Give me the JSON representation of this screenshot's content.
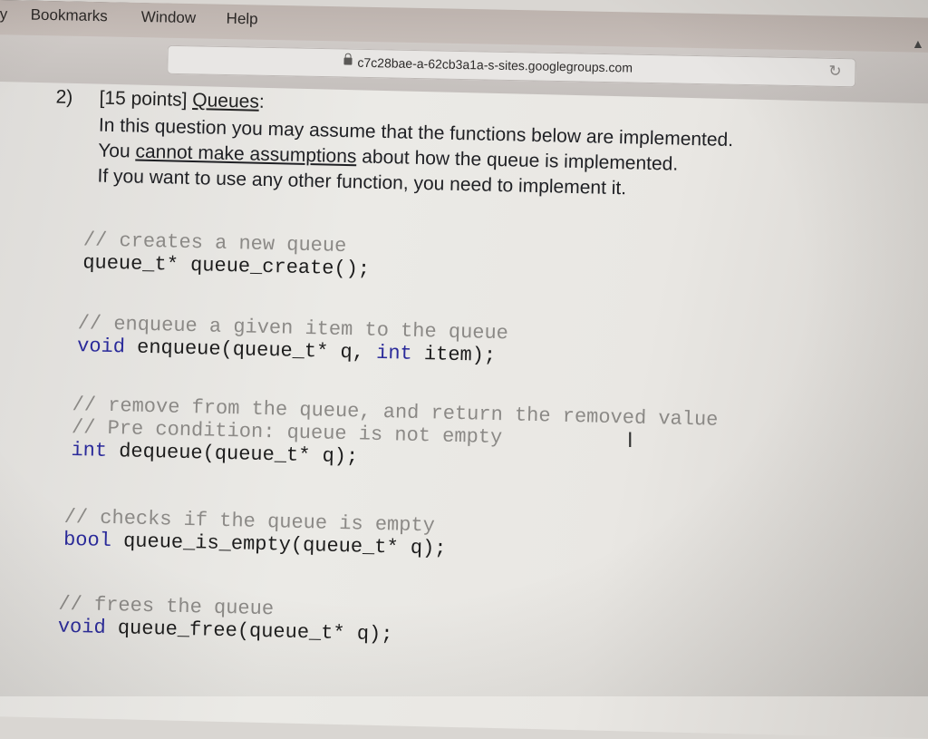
{
  "menubar": {
    "items": [
      "y",
      "Bookmarks",
      "Window",
      "Help"
    ]
  },
  "toolbar": {
    "url": "c7c28bae-a-62cb3a1a-s-sites.googlegroups.com",
    "lock_icon": "lock-icon",
    "reload_icon": "reload-icon",
    "share_icon": "share-icon"
  },
  "question": {
    "number": "2)",
    "points": "[15 points] ",
    "title": "Queues",
    "title_suffix": ":",
    "line1": "In this question you may assume that the functions below are implemented.",
    "line2_prefix": "You ",
    "line2_underlined": "cannot make assumptions",
    "line2_suffix": " about how the queue is implemented.",
    "line3": "If you want to use any other function, you need to implement it."
  },
  "code": {
    "blocks": [
      {
        "comments": [
          "// creates a new queue"
        ],
        "type": "queue_t*",
        "signature": " queue_create();"
      },
      {
        "comments": [
          "// enqueue a given item to the queue"
        ],
        "type": "void",
        "signature_a": " enqueue(queue_t* q, ",
        "param_type": "int",
        "signature_b": " item);"
      },
      {
        "comments": [
          "// remove from the queue, and return the removed value",
          "// Pre condition: queue is not empty"
        ],
        "type": "int",
        "signature": " dequeue(queue_t* q);"
      },
      {
        "comments": [
          "// checks if the queue is empty"
        ],
        "type": "bool",
        "signature": " queue_is_empty(queue_t* q);"
      },
      {
        "comments": [
          "// frees the queue"
        ],
        "type": "void",
        "signature": " queue_free(queue_t* q);"
      }
    ]
  },
  "cursor": "text-cursor-icon",
  "colors": {
    "keyword": "#2a2a9a",
    "comment": "#8b8986",
    "text": "#1c1c1c"
  }
}
